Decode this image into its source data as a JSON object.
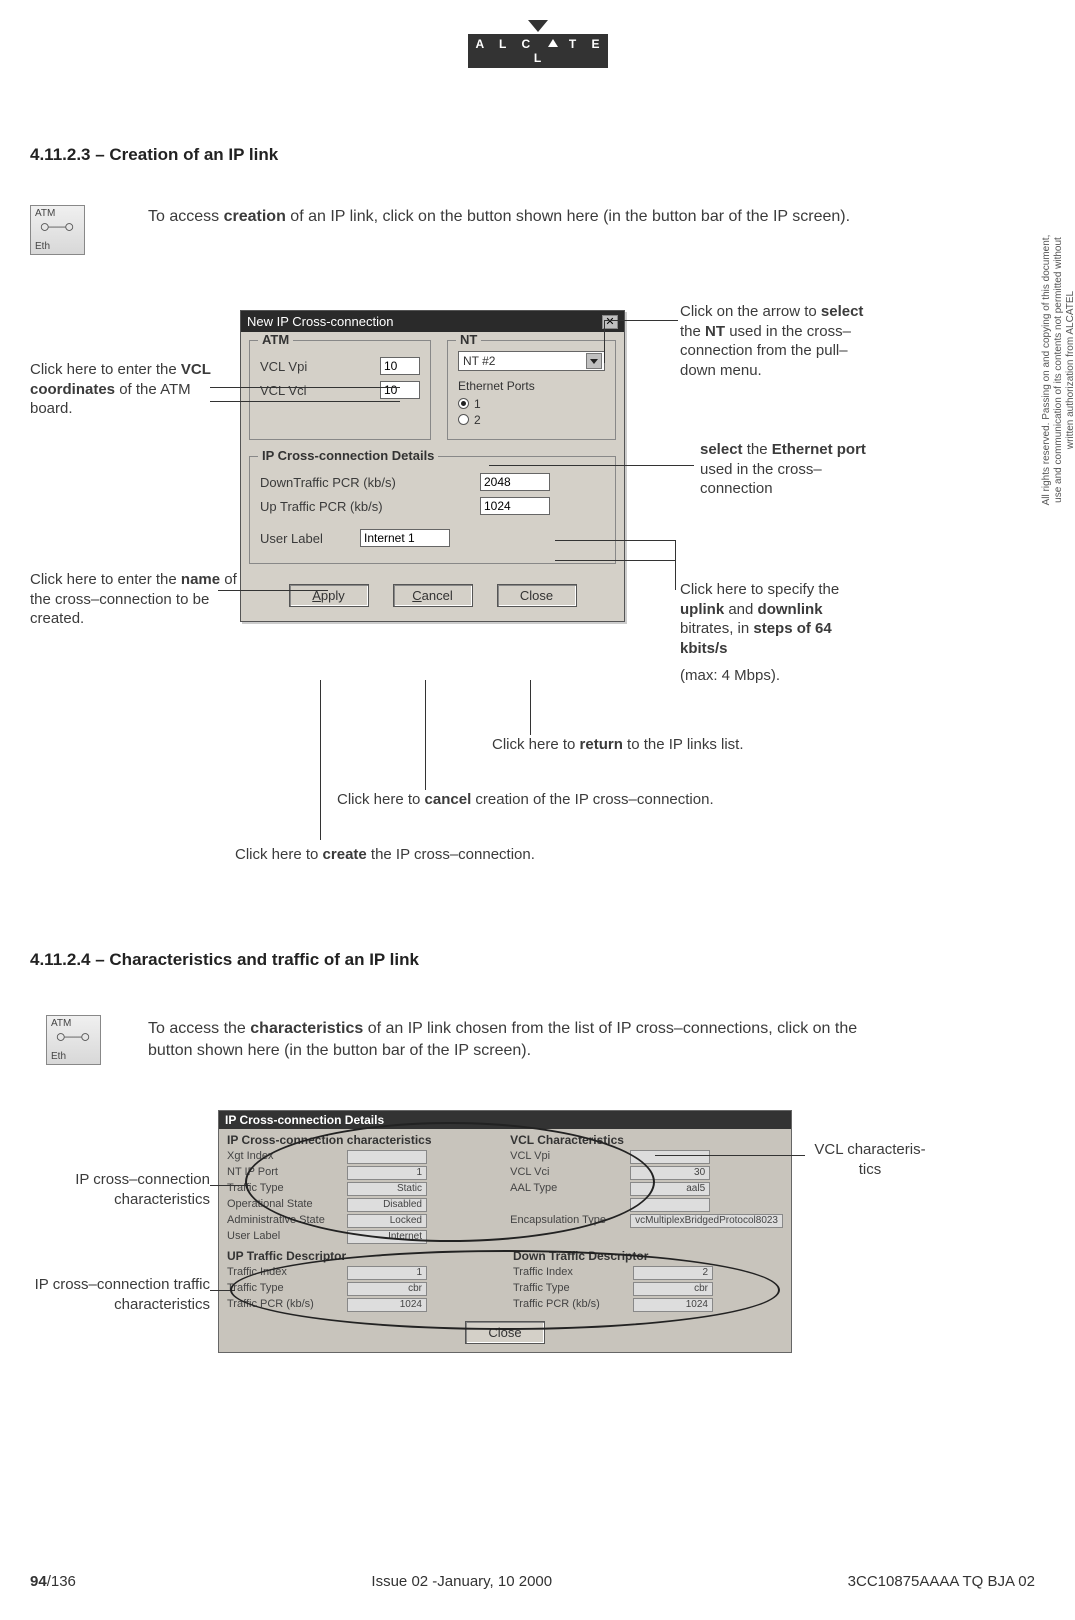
{
  "brand": "ALCATEL",
  "section1": {
    "heading": "4.11.2.3 – Creation of an IP link",
    "intro_pre": "To access ",
    "intro_bold": "creation",
    "intro_post": " of an IP link, click on the button shown here (in the button bar of the IP screen).",
    "icon_top": "ATM",
    "icon_bottom": "Eth"
  },
  "dialog": {
    "title": "New IP Cross-connection",
    "atm_legend": "ATM",
    "vpi_label": "VCL Vpi",
    "vpi_value": "10",
    "vci_label": "VCL Vci",
    "vci_value": "10",
    "nt_legend": "NT",
    "nt_selected": "NT #2",
    "eth_label": "Ethernet Ports",
    "eth_port1": "1",
    "eth_port2": "2",
    "details_legend": "IP Cross-connection Details",
    "down_label": "DownTraffic PCR (kb/s)",
    "down_value": "2048",
    "up_label": "Up Traffic PCR (kb/s)",
    "up_value": "1024",
    "user_label": "User Label",
    "user_value": "Internet 1",
    "btn_apply": "Apply",
    "btn_cancel": "Cancel",
    "btn_close": "Close"
  },
  "callouts": {
    "nt_arrow_pre": "Click on the arrow to ",
    "nt_arrow_b1": "select",
    "nt_arrow_mid": " the ",
    "nt_arrow_b2": "NT",
    "nt_arrow_post": " used in the cross–connection from the pull–down menu.",
    "vcl_pre": "Click here to enter the ",
    "vcl_bold": "VCL coordinates",
    "vcl_post": " of the ATM board.",
    "eth_b1": "select",
    "eth_mid": " the ",
    "eth_b2": "Ethernet port",
    "eth_post": " used in the cross–connection",
    "name_pre": "Click here to enter the ",
    "name_bold": "name",
    "name_post": " of the cross–connection to be created.",
    "bitrate_pre": "Click here to specify the ",
    "bitrate_b1": "uplink",
    "bitrate_mid": " and ",
    "bitrate_b2": "down­link",
    "bitrate_post1": " bitrates, in ",
    "bitrate_b3": "steps of 64 kbits/s",
    "bitrate_max": "(max: 4 Mbps).",
    "return_pre": "Click here to ",
    "return_bold": "return",
    "return_post": " to the IP links list.",
    "cancel_pre": "Click here to ",
    "cancel_bold": "cancel",
    "cancel_post": " creation of the IP cross–connection.",
    "create_pre": "Click here to ",
    "create_bold": "create",
    "create_post": " the IP cross–connection."
  },
  "section2": {
    "heading": "4.11.2.4 – Characteristics and traffic of an IP link",
    "intro_pre": "To access the ",
    "intro_bold": "characteristics",
    "intro_post": " of an IP link chosen from the list of IP cross–connections, click on the button shown here (in the button bar of the IP screen).",
    "icon_top": "ATM",
    "icon_bottom": "Eth"
  },
  "details_panel": {
    "title": "IP Cross-connection Details",
    "ipchar_header": "IP Cross-connection characteristics",
    "vcl_header": "VCL Characteristics",
    "up_header": "UP Traffic Descriptor",
    "down_header": "Down Traffic Descriptor",
    "fields": {
      "ip": [
        {
          "lbl": "Xgt Index",
          "val": ""
        },
        {
          "lbl": "NT IP Port",
          "val": "1"
        },
        {
          "lbl": "Traffic Type",
          "val": "Static"
        },
        {
          "lbl": "Operational State",
          "val": "Disabled"
        },
        {
          "lbl": "Administrative State",
          "val": "Locked"
        },
        {
          "lbl": "User Label",
          "val": "Internet"
        }
      ],
      "vcl": [
        {
          "lbl": "VCL Vpi",
          "val": ""
        },
        {
          "lbl": "VCL Vci",
          "val": "30"
        },
        {
          "lbl": "AAL Type",
          "val": "aal5"
        },
        {
          "lbl": "",
          "val": ""
        },
        {
          "lbl": "Encapsulation Type",
          "val": "vcMultiplexBridgedProtocol8023"
        }
      ],
      "up": [
        {
          "lbl": "Traffic Index",
          "val": "1"
        },
        {
          "lbl": "Traffic Type",
          "val": "cbr"
        },
        {
          "lbl": "Traffic PCR (kb/s)",
          "val": "1024"
        }
      ],
      "down": [
        {
          "lbl": "Traffic Index",
          "val": "2"
        },
        {
          "lbl": "Traffic Type",
          "val": "cbr"
        },
        {
          "lbl": "Traffic PCR (kb/s)",
          "val": "1024"
        }
      ]
    },
    "btn_close": "Close"
  },
  "detail_callouts": {
    "ip_char": "IP cross–connection characteristics",
    "ip_traffic": "IP cross–connection traffic characteristics",
    "vcl_char": "VCL characteris­tics"
  },
  "rights": "All rights reserved. Passing on and copying of this document, use and communication of its contents not permitted without written authorization from ALCATEL",
  "footer": {
    "page": "94",
    "total": "/136",
    "issue": "Issue 02 -January, 10 2000",
    "docid": "3CC10875AAAA TQ BJA 02"
  }
}
